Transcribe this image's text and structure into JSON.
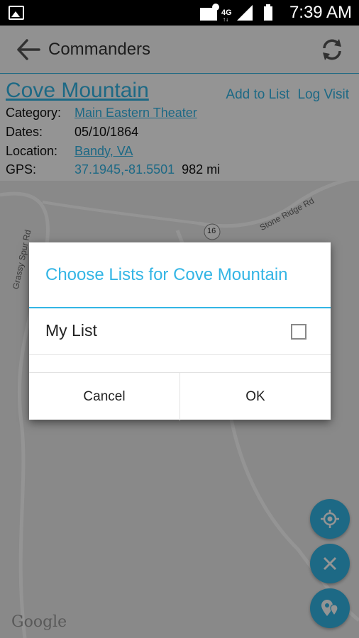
{
  "status_bar": {
    "time": "7:39 AM",
    "icons": [
      "gallery-icon",
      "wifi-calling-icon",
      "lte-icon",
      "signal-icon",
      "battery-icon"
    ]
  },
  "app_bar": {
    "title": "Commanders",
    "icons": [
      "back-arrow-icon",
      "refresh-icon"
    ]
  },
  "details": {
    "title": "Cove Mountain",
    "add_to_list": "Add to List",
    "log_visit": "Log Visit",
    "category_label": "Category:",
    "category_value": "Main Eastern Theater",
    "dates_label": "Dates:",
    "dates_value": "05/10/1864",
    "location_label": "Location:",
    "location_value": "Bandy, VA",
    "gps_label": "GPS:",
    "gps_value": "37.1945,-81.5501",
    "distance": "982 mi"
  },
  "map": {
    "road_labels": [
      "Grassy Spur Rd",
      "Stone Ridge Rd"
    ],
    "route_number": "16",
    "logo": "Google",
    "fab_icons": [
      "my-location-icon",
      "close-icon",
      "markers-icon"
    ]
  },
  "dialog": {
    "title": "Choose Lists for Cove Mountain",
    "list_item": "My List",
    "checked": false,
    "cancel": "Cancel",
    "ok": "OK"
  },
  "colors": {
    "accent": "#33b5e5",
    "scrim": "rgba(0,0,0,0.42)"
  }
}
